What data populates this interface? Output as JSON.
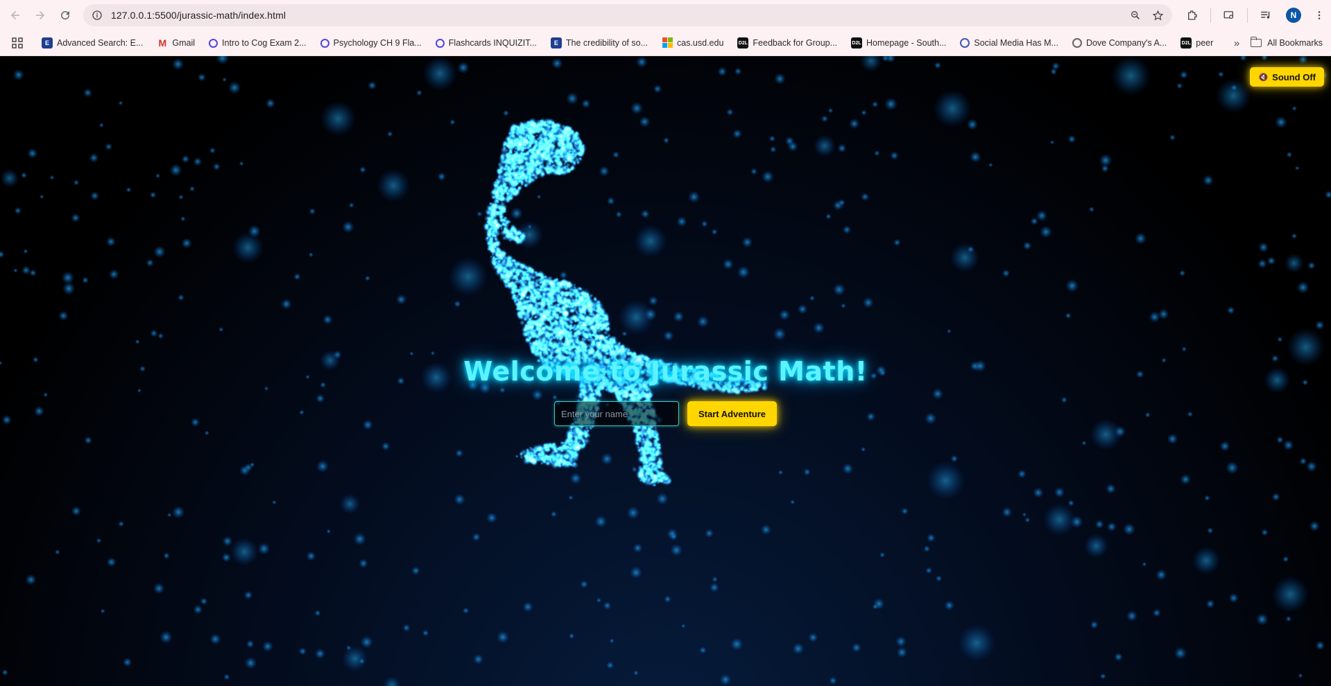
{
  "browser": {
    "url": "127.0.0.1:5500/jurassic-math/index.html",
    "profile_initial": "N"
  },
  "bookmarks": [
    {
      "label": "Advanced Search: E...",
      "icon": "ebsco-icon"
    },
    {
      "label": "Gmail",
      "icon": "gmail-icon"
    },
    {
      "label": "Intro to Cog Exam 2...",
      "icon": "quizlet-icon"
    },
    {
      "label": "Psychology CH 9 Fla...",
      "icon": "quizlet-icon"
    },
    {
      "label": "Flashcards INQUIZIT...",
      "icon": "quizlet-icon"
    },
    {
      "label": "The credibility of so...",
      "icon": "ebsco-icon"
    },
    {
      "label": "cas.usd.edu",
      "icon": "microsoft-icon"
    },
    {
      "label": "Feedback for Group...",
      "icon": "d2l-icon"
    },
    {
      "label": "Homepage - South...",
      "icon": "d2l-icon"
    },
    {
      "label": "Social Media Has M...",
      "icon": "globe-icon"
    },
    {
      "label": "Dove Company's A...",
      "icon": "globe-icon"
    },
    {
      "label": "peer",
      "icon": "d2l-icon"
    }
  ],
  "all_bookmarks_label": "All Bookmarks",
  "page": {
    "sound_button_label": "Sound Off",
    "title": "Welcome to Jurassic Math!",
    "name_placeholder": "Enter your name",
    "start_button_label": "Start Adventure"
  },
  "colors": {
    "accent_yellow": "#ffd600",
    "neon_cyan": "#5ef2ff",
    "particle_blue": "#1fa8e0"
  }
}
